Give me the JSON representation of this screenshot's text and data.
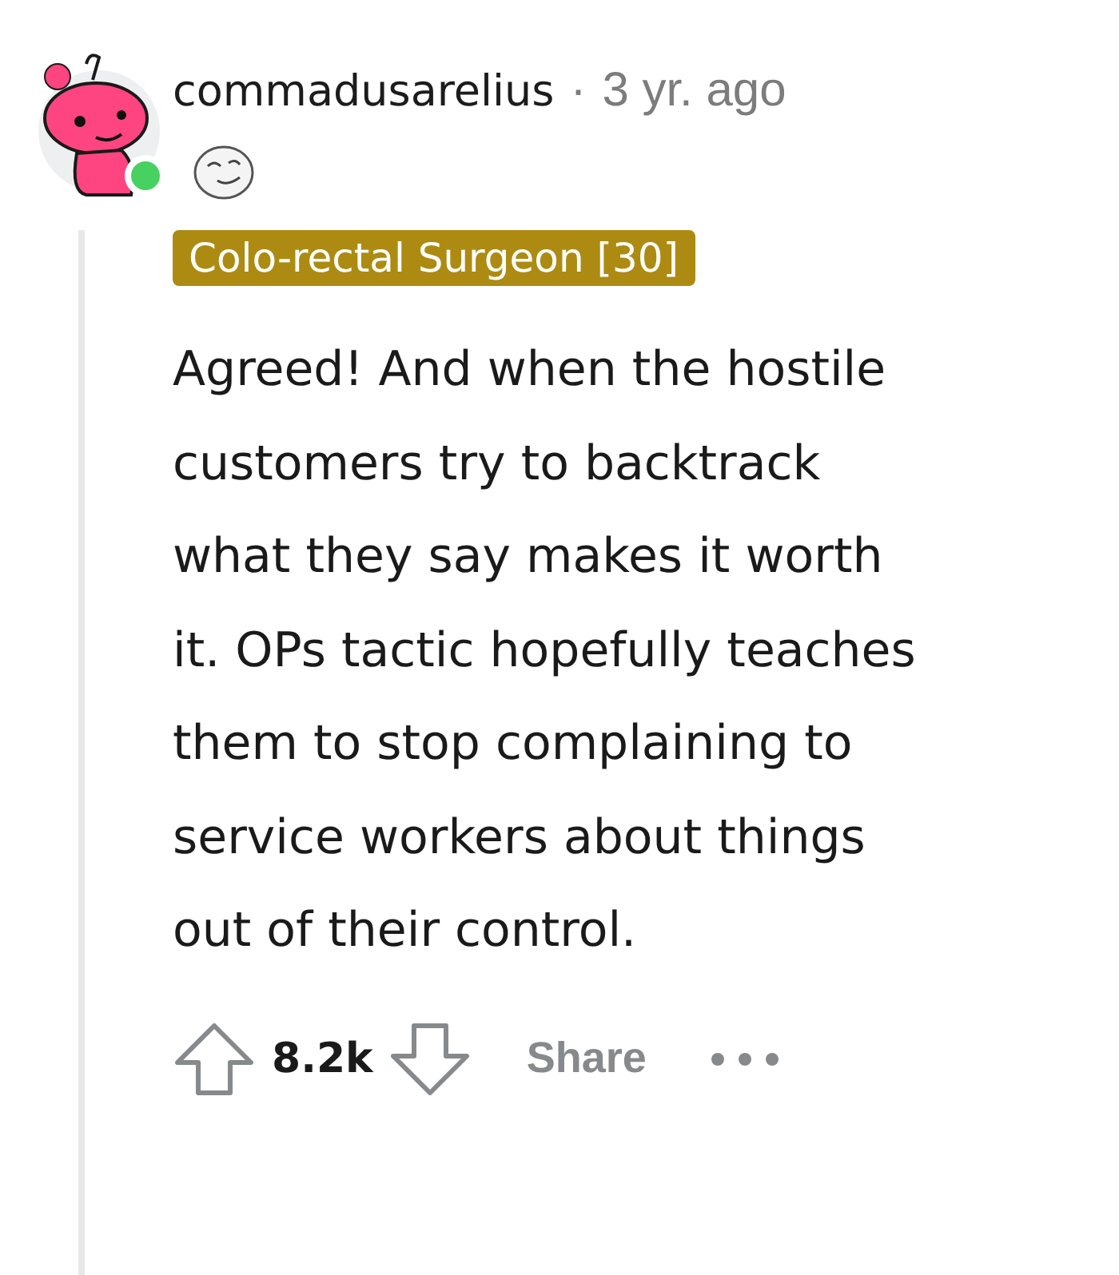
{
  "comment": {
    "author": "commadusarelius",
    "separator": "·",
    "time": "3 yr. ago",
    "online": true,
    "flair": "Colo-rectal Surgeon [30]",
    "body": "Agreed! And when the hostile customers try to backtrack what they say makes it worth it. OPs tactic hopefully teaches them to stop complaining to service workers about things out of their control.",
    "score": "8.2k",
    "share": "Share"
  }
}
